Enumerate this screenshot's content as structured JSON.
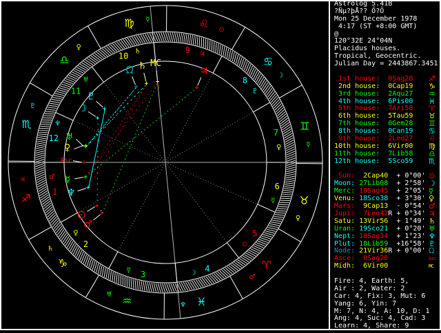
{
  "colors": {
    "white": "#ffffff",
    "red": "#ff0000",
    "yellow": "#ffff00",
    "green": "#00ff00",
    "cyan": "#00ffff",
    "teal": "#009f9f",
    "axis_gray": "#b4b4b4",
    "cusp_gray": "#8c8c8c",
    "hatch": "#e2e2e2",
    "circle": "#ffffff",
    "pointer": "#ffffff",
    "background": "#000000"
  },
  "header": {
    "title": "Astrolog 5.41B",
    "location": "?Ñµ?þÅ?? Ő?Ő",
    "date": "Mon 25 December 1978",
    "time": " 4:17 (ST +8:00 GMT)",
    "at": "@",
    "coords": "120°32E 24°04N",
    "house_system": "Placidus houses.",
    "zodiac_type": "Tropical, Geocentric.",
    "julian_day": "Julian Day = 2443867.3451"
  },
  "houses": [
    {
      "label": " 1st house:",
      "value": " 0Sag28",
      "color": "red",
      "glyph": "♐"
    },
    {
      "label": " 2nd house:",
      "value": " 0Cap19",
      "color": "yellow",
      "glyph": "♑"
    },
    {
      "label": " 3rd house:",
      "value": " 2Aqu27",
      "color": "green",
      "glyph": "♒"
    },
    {
      "label": " 4th house:",
      "value": " 6Pis00",
      "color": "cyan",
      "glyph": "♓"
    },
    {
      "label": " 5th house:",
      "value": " 7Ari58",
      "color": "red",
      "glyph": "♈"
    },
    {
      "label": " 6th house:",
      "value": " 5Tau59",
      "color": "yellow",
      "glyph": "♉"
    },
    {
      "label": " 7th house:",
      "value": " 0Gem28",
      "color": "green",
      "glyph": "♊"
    },
    {
      "label": " 8th house:",
      "value": " 0Can19",
      "color": "cyan",
      "glyph": "♋"
    },
    {
      "label": " 9th house:",
      "value": " 2Leo27",
      "color": "red",
      "glyph": "♌"
    },
    {
      "label": "10th house:",
      "value": " 6Vir00",
      "color": "yellow",
      "glyph": "♍"
    },
    {
      "label": "11th house:",
      "value": " 7Lib58",
      "color": "green",
      "glyph": "♎"
    },
    {
      "label": "12th house:",
      "value": " 5Sco59",
      "color": "cyan",
      "glyph": "♏"
    }
  ],
  "objects": [
    {
      "label": " Sun:",
      "pos": "  2Cap40",
      "retro": " ",
      "vel": "+ 0°00'",
      "labelColor": "red",
      "posColor": "yellow",
      "glyph": "⊙",
      "glyphColor": "red"
    },
    {
      "label": "Moon:",
      "pos": " 27Lib08",
      "retro": " ",
      "vel": "+ 2°58'",
      "labelColor": "cyan",
      "posColor": "green",
      "glyph": "☽",
      "glyphColor": "cyan"
    },
    {
      "label": "Merc:",
      "pos": " 10Sag45",
      "retro": " ",
      "vel": "+ 2°05'",
      "labelColor": "green",
      "posColor": "red",
      "glyph": "☿",
      "glyphColor": "green"
    },
    {
      "label": "Venu:",
      "pos": " 18Sco38",
      "retro": " ",
      "vel": "+ 3°30'",
      "labelColor": "yellow",
      "posColor": "cyan",
      "glyph": "♀",
      "glyphColor": "yellow"
    },
    {
      "label": "Mars:",
      "pos": "  9Cap13",
      "retro": " ",
      "vel": "- 0°54'",
      "labelColor": "red",
      "posColor": "yellow",
      "glyph": "♂",
      "glyphColor": "red"
    },
    {
      "label": "Jupi:",
      "pos": "  7Leo42",
      "retro": "R",
      "vel": "+ 0°34'",
      "labelColor": "red",
      "posColor": "red",
      "glyph": "♃",
      "glyphColor": "red"
    },
    {
      "label": "Satu:",
      "pos": " 13Vir56",
      "retro": " ",
      "vel": "+ 1°49'",
      "labelColor": "yellow",
      "posColor": "yellow",
      "glyph": "♄",
      "glyphColor": "yellow"
    },
    {
      "label": "Uran:",
      "pos": " 19Sco21",
      "retro": " ",
      "vel": "+ 0°20'",
      "labelColor": "green",
      "posColor": "cyan",
      "glyph": "♅",
      "glyphColor": "green"
    },
    {
      "label": "Nept:",
      "pos": " 18Sag34",
      "retro": " ",
      "vel": "+ 1°23'",
      "labelColor": "cyan",
      "posColor": "red",
      "glyph": "♆",
      "glyphColor": "cyan"
    },
    {
      "label": "Plut:",
      "pos": " 18Lib59",
      "retro": " ",
      "vel": "+16°58'",
      "labelColor": "cyan",
      "posColor": "green",
      "glyph": "♇",
      "glyphColor": "cyan"
    },
    {
      "label": "Node:",
      "pos": " 21Vir36",
      "retro": "R",
      "vel": "+ 0°00'",
      "labelColor": "teal",
      "posColor": "yellow",
      "glyph": "Ω",
      "glyphColor": "teal"
    },
    {
      "label": "Asce:",
      "pos": "  0Sag28",
      "retro": " ",
      "vel": "",
      "labelColor": "red",
      "posColor": "red",
      "glyph": "Asc",
      "glyphColor": "red",
      "textGlyph": true
    },
    {
      "label": "Midh:",
      "pos": "  6Vir00",
      "retro": " ",
      "vel": "",
      "labelColor": "yellow",
      "posColor": "yellow",
      "glyph": "MC",
      "glyphColor": "yellow",
      "textGlyph": true
    }
  ],
  "footer": [
    "Fire: 4, Earth: 5,",
    "Air : 2, Water: 2",
    "Car: 4, Fix: 3, Mut: 6",
    "Yang: 6, Yin: 7",
    "M: 7, N: 4, A: 10, D: 1",
    "Ang: 4, Suc: 4, Cad: 3",
    "Learn: 4, Share: 9"
  ],
  "wheel": {
    "asc_lon": 240.467,
    "cusps": [
      240.467,
      270.317,
      302.45,
      336.0,
      7.967,
      35.983,
      60.467,
      90.317,
      122.45,
      156.0,
      187.967,
      215.983
    ],
    "house_numbers": [
      "1",
      "2",
      "3",
      "4",
      "5",
      "6",
      "7",
      "8",
      "9",
      "10",
      "11",
      "12"
    ],
    "house_colors": [
      "red",
      "yellow",
      "green",
      "cyan",
      "red",
      "yellow",
      "green",
      "cyan",
      "red",
      "yellow",
      "green",
      "cyan"
    ],
    "house_rulers": [
      {
        "glyph": "♂",
        "color": "red"
      },
      {
        "glyph": "♀",
        "color": "yellow"
      },
      {
        "glyph": "☿",
        "color": "green"
      },
      {
        "glyph": "☽",
        "color": "cyan"
      },
      {
        "glyph": "⊙",
        "color": "red"
      },
      {
        "glyph": "☿",
        "color": "green"
      },
      {
        "glyph": "♀",
        "color": "yellow"
      },
      {
        "glyph": "♇",
        "color": "cyan"
      },
      {
        "glyph": "♃",
        "color": "red"
      },
      {
        "glyph": "♄",
        "color": "yellow"
      },
      {
        "glyph": "♅",
        "color": "green"
      },
      {
        "glyph": "♆",
        "color": "cyan"
      }
    ],
    "signs": [
      {
        "name": "Aries",
        "glyph": "♈",
        "color": "red",
        "ruler": "♂",
        "rulerColor": "red"
      },
      {
        "name": "Taurus",
        "glyph": "♉",
        "color": "yellow",
        "ruler": "♀",
        "rulerColor": "yellow"
      },
      {
        "name": "Gemini",
        "glyph": "♊",
        "color": "green",
        "ruler": "☿",
        "rulerColor": "green"
      },
      {
        "name": "Cancer",
        "glyph": "♋",
        "color": "cyan",
        "ruler": "☽",
        "rulerColor": "cyan"
      },
      {
        "name": "Leo",
        "glyph": "♌",
        "color": "red",
        "ruler": "⊙",
        "rulerColor": "red"
      },
      {
        "name": "Virgo",
        "glyph": "♍",
        "color": "yellow",
        "ruler": "☿",
        "rulerColor": "green"
      },
      {
        "name": "Libra",
        "glyph": "♎",
        "color": "green",
        "ruler": "♀",
        "rulerColor": "yellow"
      },
      {
        "name": "Scorpio",
        "glyph": "♏",
        "color": "cyan",
        "ruler": "♇",
        "rulerColor": "cyan"
      },
      {
        "name": "Sagittarius",
        "glyph": "♐",
        "color": "red",
        "ruler": "♃",
        "rulerColor": "red"
      },
      {
        "name": "Capricorn",
        "glyph": "♑",
        "color": "yellow",
        "ruler": "♄",
        "rulerColor": "yellow"
      },
      {
        "name": "Aquarius",
        "glyph": "♒",
        "color": "green",
        "ruler": "♅",
        "rulerColor": "green"
      },
      {
        "name": "Pisces",
        "glyph": "♓",
        "color": "cyan",
        "ruler": "♆",
        "rulerColor": "cyan"
      }
    ],
    "planets": [
      {
        "name": "Sun",
        "lon": 272.667,
        "glyph": "⊙",
        "color": "red",
        "fs": 17,
        "adj": 0
      },
      {
        "name": "Moon",
        "lon": 207.133,
        "glyph": "☽",
        "color": "cyan",
        "fs": 15,
        "adj": 0
      },
      {
        "name": "Merc",
        "lon": 250.75,
        "glyph": "☿",
        "color": "green",
        "fs": 13,
        "adj": 0
      },
      {
        "name": "Venu",
        "lon": 228.633,
        "glyph": "♀",
        "color": "yellow",
        "fs": 13,
        "adj": 3.5
      },
      {
        "name": "Mars",
        "lon": 279.217,
        "glyph": "♂",
        "color": "red",
        "fs": 15,
        "adj": 0
      },
      {
        "name": "Jupi",
        "lon": 127.7,
        "glyph": "♃",
        "color": "red",
        "fs": 15,
        "adj": 0
      },
      {
        "name": "Satu",
        "lon": 163.933,
        "glyph": "♄",
        "color": "yellow",
        "fs": 14,
        "adj": 0
      },
      {
        "name": "Uran",
        "lon": 229.35,
        "glyph": "♅",
        "color": "green",
        "fs": 13,
        "adj": -3.5
      },
      {
        "name": "Nept",
        "lon": 258.567,
        "glyph": "♆",
        "color": "cyan",
        "fs": 14,
        "adj": 0
      },
      {
        "name": "Plut",
        "lon": 198.983,
        "glyph": "♇",
        "color": "cyan",
        "fs": 14,
        "adj": 0
      },
      {
        "name": "Node",
        "lon": 171.6,
        "glyph": "Ω",
        "color": "teal",
        "fs": 15,
        "adj": 0
      },
      {
        "name": "Asc",
        "lon": 240.467,
        "glyph": "Asc",
        "color": "red",
        "fs": 10,
        "adj": -1,
        "textGlyph": true
      },
      {
        "name": "MC",
        "lon": 156.0,
        "glyph": "MC",
        "color": "yellow",
        "fs": 13,
        "adj": 0,
        "textGlyph": true
      }
    ],
    "aspects": [
      {
        "a": "Moon",
        "b": "Sun",
        "type": "sextile",
        "color": "cyan",
        "orb": 5.53
      },
      {
        "a": "Merc",
        "b": "Jupi",
        "type": "trine",
        "color": "green",
        "orb": 3.05
      },
      {
        "a": "Merc",
        "b": "Satu",
        "type": "square",
        "color": "red",
        "orb": 3.19
      },
      {
        "a": "Merc",
        "b": "MC",
        "type": "square",
        "color": "red",
        "orb": 4.75
      },
      {
        "a": "Venu",
        "b": "Uran",
        "type": "conjunct",
        "color": "yellow",
        "orb": 0.72
      },
      {
        "a": "Venu",
        "b": "Satu",
        "type": "sextile",
        "color": "cyan",
        "orb": 4.7
      },
      {
        "a": "Venu",
        "b": "Node",
        "type": "sextile",
        "color": "cyan",
        "orb": 2.97
      },
      {
        "a": "Satu",
        "b": "Uran",
        "type": "sextile",
        "color": "cyan",
        "orb": 5.42
      },
      {
        "a": "Satu",
        "b": "Nept",
        "type": "square",
        "color": "red",
        "orb": 4.63
      },
      {
        "a": "Uran",
        "b": "Node",
        "type": "sextile",
        "color": "cyan",
        "orb": 2.25
      },
      {
        "a": "Nept",
        "b": "Plut",
        "type": "sextile",
        "color": "cyan",
        "orb": 0.42
      },
      {
        "a": "Mars",
        "b": "MC",
        "type": "trine",
        "color": "green",
        "orb": 3.22
      },
      {
        "a": "Sun",
        "b": "Mars",
        "type": "conjunct",
        "color": "yellow",
        "orb": 6.55
      }
    ]
  }
}
